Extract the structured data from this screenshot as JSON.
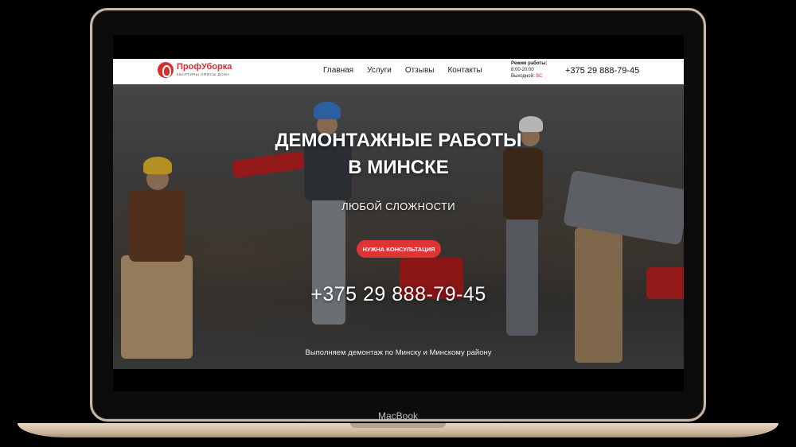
{
  "device": {
    "brand_label": "MacBook"
  },
  "site": {
    "logo": {
      "name": "ПрофУборка",
      "tagline": "квартиры офисы дома"
    },
    "nav": [
      {
        "label": "Главная"
      },
      {
        "label": "Услуги"
      },
      {
        "label": "Отзывы"
      },
      {
        "label": "Контакты"
      }
    ],
    "hours": {
      "title": "Режим работы:",
      "time": "8:00-20:00",
      "day_off_label": "Выходной:",
      "day_off_value": "ВС"
    },
    "header_phone": "+375 29 888-79-45"
  },
  "hero": {
    "title_line1": "ДЕМОНТАЖНЫЕ РАБОТЫ",
    "title_line2": "В МИНСКЕ",
    "subtitle": "ЛЮБОЙ СЛОЖНОСТИ",
    "cta_label": "Нужна консультация",
    "phone": "+375 29 888-79-45",
    "footer_text": "Выполняем демонтаж по Минску и Минскому району"
  },
  "colors": {
    "accent": "#e03434",
    "brand_red": "#d72f2f",
    "header_bg": "#ffffff"
  }
}
